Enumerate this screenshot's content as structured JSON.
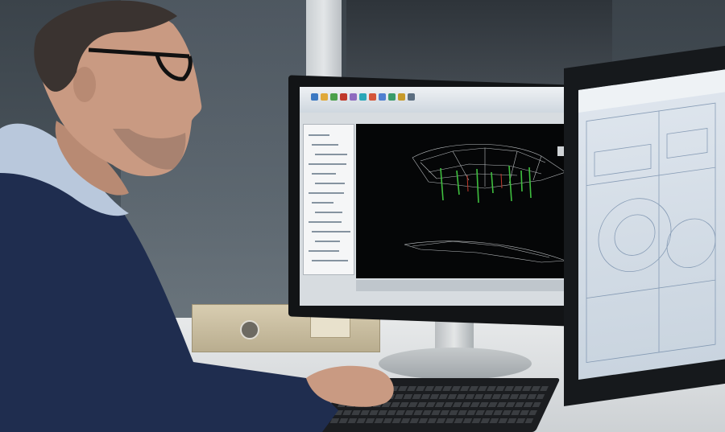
{
  "scene": {
    "description_free": true,
    "colors": {
      "sweater": "#1f2d4f",
      "shirt": "#b9c8dc",
      "skin": "#c99a82",
      "hair": "#3a3330",
      "glasses": "#111111",
      "viewport_bg": "#050607",
      "mesh": "#d9dde0",
      "drillholes": "#3fbf3f",
      "blueprint": "#6d86a5"
    }
  },
  "screen_main": {
    "ribbon_icons": [
      "model-icon",
      "layers-icon",
      "settings-icon",
      "grid-icon",
      "paint-icon",
      "cube-icon",
      "gear-icon",
      "globe-icon",
      "shield-icon",
      "flag-icon",
      "help-icon"
    ],
    "tree_lines": 14
  }
}
